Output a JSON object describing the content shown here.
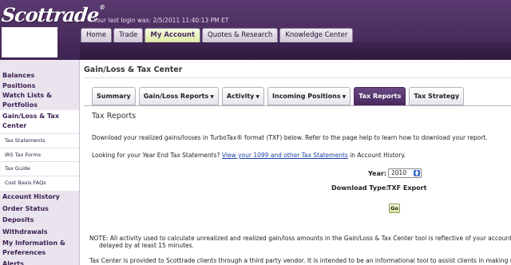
{
  "header": {
    "logo_text": "Scottrade",
    "last_login": "Your last login was: 2/5/2011 11:40:13 PM ET",
    "tabs": [
      {
        "label": "Home",
        "active": false
      },
      {
        "label": "Trade",
        "active": false
      },
      {
        "label": "My Account",
        "active": true
      },
      {
        "label": "Quotes & Research",
        "active": false
      },
      {
        "label": "Knowledge Center",
        "active": false
      }
    ]
  },
  "sidebar": {
    "items": [
      {
        "label": "Balances"
      },
      {
        "label": "Positions"
      },
      {
        "label": "Watch Lists &"
      },
      {
        "label": "Portfolios"
      },
      {
        "label": "Gain/Loss & Tax"
      },
      {
        "label": "Center"
      },
      {
        "label": "Tax Statements"
      },
      {
        "label": "IRS Tax Forms"
      },
      {
        "label": "Tax Guide"
      },
      {
        "label": "Cost Basis FAQs"
      },
      {
        "label": "Account History"
      },
      {
        "label": "Order Status"
      },
      {
        "label": "Deposits"
      },
      {
        "label": "Withdrawals"
      },
      {
        "label": "My Information &"
      },
      {
        "label": "Preferences"
      },
      {
        "label": "Alerts"
      }
    ]
  },
  "main": {
    "page_title": "Gain/Loss & Tax Center",
    "subtabs": [
      {
        "label": "Summary",
        "dropdown": false
      },
      {
        "label": "Gain/Loss Reports",
        "dropdown": true
      },
      {
        "label": "Activity",
        "dropdown": true
      },
      {
        "label": "Incoming Positions",
        "dropdown": true
      },
      {
        "label": "Tax Reports",
        "dropdown": false,
        "active": true
      },
      {
        "label": "Tax Strategy",
        "dropdown": false
      }
    ],
    "section_title": "Tax Reports",
    "intro": "Download your realized gains/losses in TurboTax® format (TXF) below. Refer to the page help to learn how to download your report.",
    "year_end_prefix": "Looking for your Year End Tax Statements?",
    "year_end_link": "View your 1099 and other Tax Statements",
    "year_end_suffix": "in Account History.",
    "form": {
      "year_label": "Year:",
      "year_value": "2010",
      "download_type_label": "Download Type:",
      "download_type_value": "TXF Export",
      "go_label": "Go"
    },
    "note_line1": "NOTE: All activity used to calculate unrealized and realized gain/loss amounts in the Gain/Loss & Tax Center tool is reflective of your account'",
    "note_line2": "delayed by at least 15 minutes.",
    "footer_text": "Tax Center is provided to Scottrade clients through a third party vendor. It is intended to be an informational tool to assist clients in making r"
  },
  "colors": {
    "brand_purple": "#4a2a5e",
    "active_tab_green": "#dbe9a0",
    "link_blue": "#1a3fa8"
  }
}
